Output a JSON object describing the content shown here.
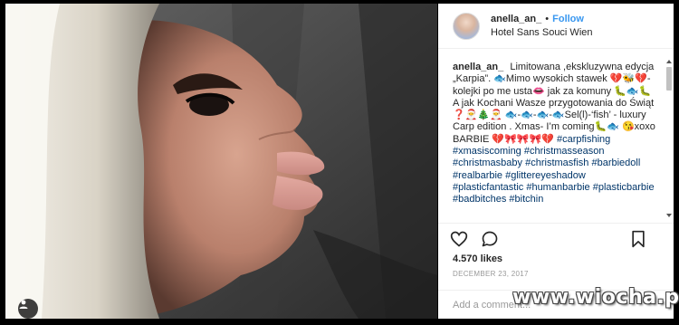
{
  "post": {
    "username": "anella_an_",
    "separator": "•",
    "follow_label": "Follow",
    "location": "Hotel Sans Souci Wien",
    "caption_user": "anella_an_",
    "caption_text": "Limitowana ,ekskluzywna edycja „Karpia”. 🐟Mimo wysokich stawek 💔🐝💔- kolejki po me usta👄 jak za komuny 🐛🐟🐛 A jak Kochani Wasze przygotowania do Świąt ❓🎅🎄🎅 🐟-🐟-🐟-🐟Sel(l)-‘fish’ - luxury Carp edition . Xmas- I’m coming🐛🐟 😘xoxo BARBIE 💔🎀🎀🎀💔",
    "hashtags": [
      "#carpfishing",
      "#xmasiscoming",
      "#christmasseason",
      "#christmasbaby",
      "#christmasfish",
      "#barbiedoll",
      "#realbarbie",
      "#glittereyeshadow",
      "#plasticfantastic",
      "#humanbarbie",
      "#plasticbarbie",
      "#badbitches",
      "#bitchin"
    ],
    "likes": "4.570 likes",
    "date": "DECEMBER 23, 2017",
    "comment_placeholder": "Add a comment..."
  },
  "watermark": "www.wiocha.pl",
  "icons": {
    "like": "heart-icon",
    "comment": "comment-icon",
    "save": "bookmark-icon",
    "tag": "user-tag-icon"
  },
  "colors": {
    "follow": "#3897f0",
    "hashtag": "#003569",
    "text": "#262626",
    "muted": "#999999"
  }
}
